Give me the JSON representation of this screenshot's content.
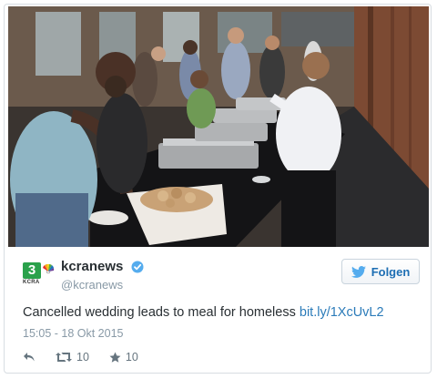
{
  "tweet": {
    "account": {
      "display_name": "kcranews",
      "handle": "@kcranews",
      "logo_number": "3",
      "logo_call_sign": "KCRA",
      "verified": true,
      "verified_icon": "verified-badge-icon"
    },
    "follow_button": {
      "label": "Folgen",
      "icon": "twitter-bird-icon"
    },
    "text": "Cancelled wedding leads to meal for homeless",
    "link": "bit.ly/1XcUvL2",
    "timestamp": "15:05 - 18 Okt 2015",
    "actions": {
      "reply_icon": "reply-icon",
      "retweet_icon": "retweet-icon",
      "retweet_count": "10",
      "like_icon": "star-icon",
      "like_count": "10"
    },
    "colors": {
      "link": "#2b7bb9",
      "text": "#292f33",
      "muted": "#8899a6",
      "logo_green": "#2aa14b"
    }
  }
}
